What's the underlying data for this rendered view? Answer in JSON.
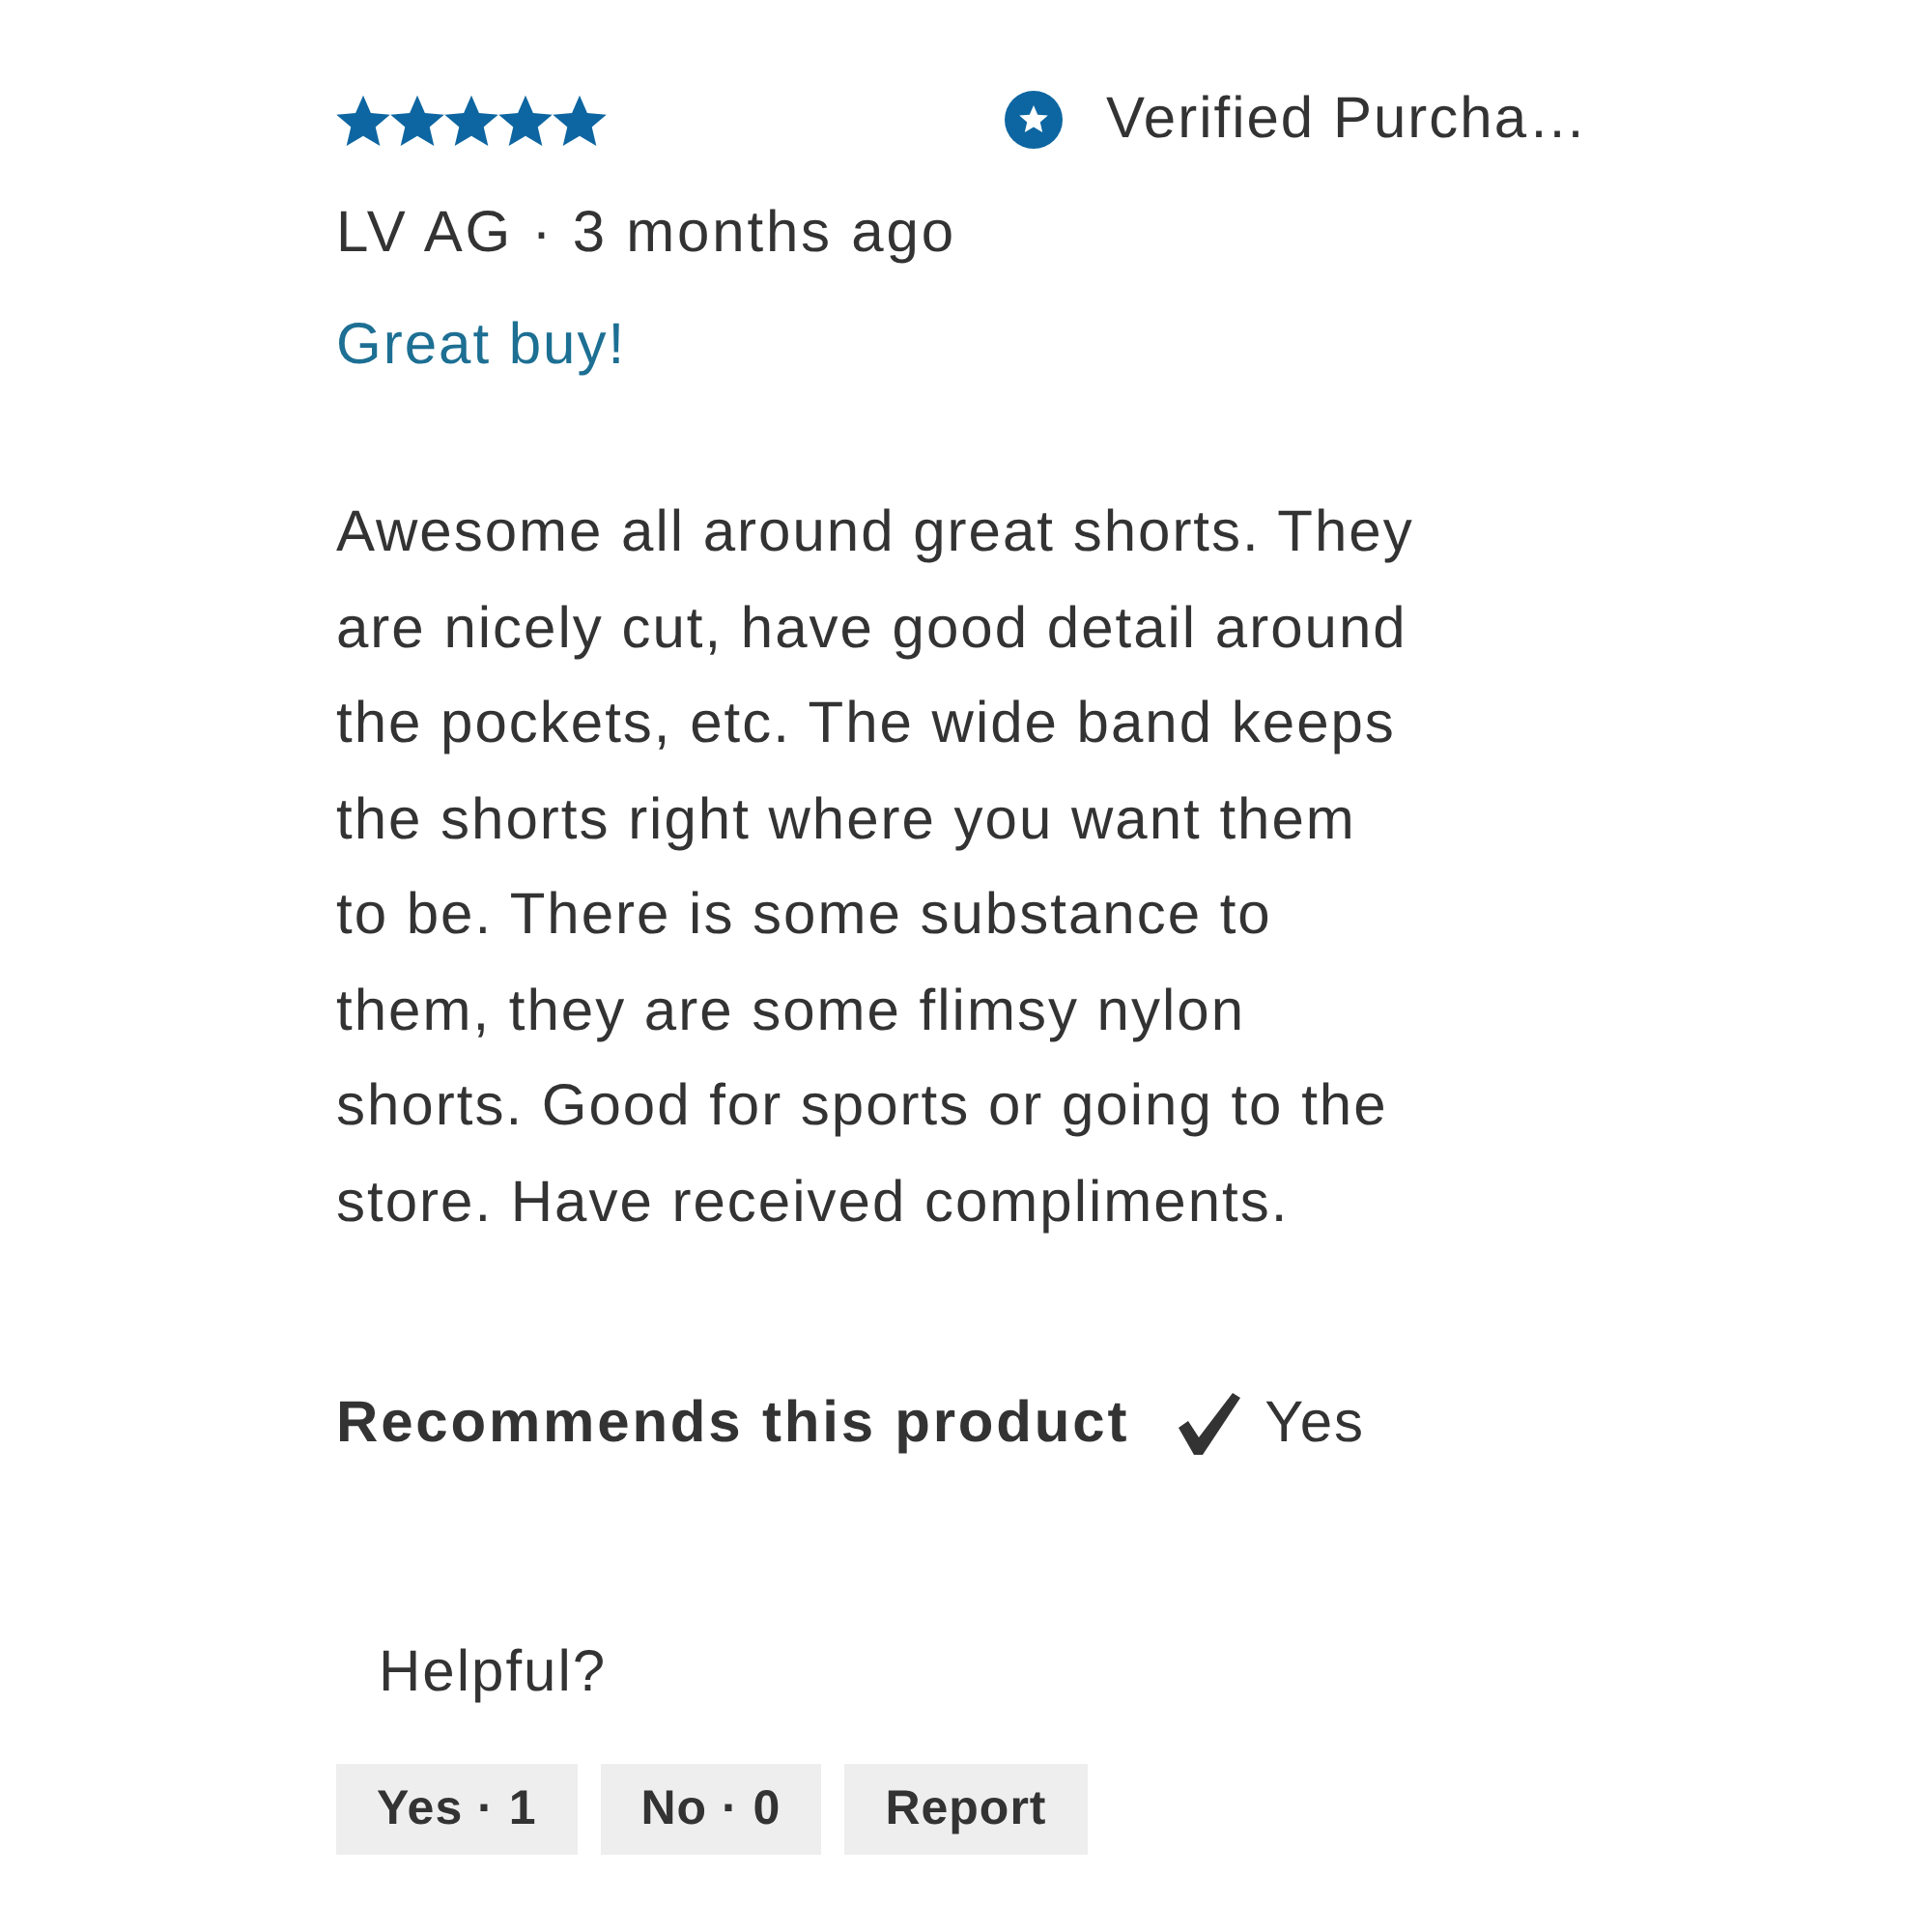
{
  "review": {
    "stars": 5,
    "badge": "Verified Purcha…",
    "byline": "LV AG · 3 months ago",
    "title": "Great buy!",
    "body": "Awesome all around great shorts. They are nicely cut, have good detail around the pockets, etc. The wide band keeps the shorts right where you want them to be. There is some substance to them, they are some flimsy nylon shorts. Good for sports or going to the store. Have received compliments.",
    "recommendation": {
      "label": "Recommends this product",
      "checked": true,
      "value": "Yes"
    },
    "helpful": {
      "label": "Helpful?",
      "buttons": [
        "Yes · 1",
        "No · 0",
        "Report"
      ]
    }
  }
}
